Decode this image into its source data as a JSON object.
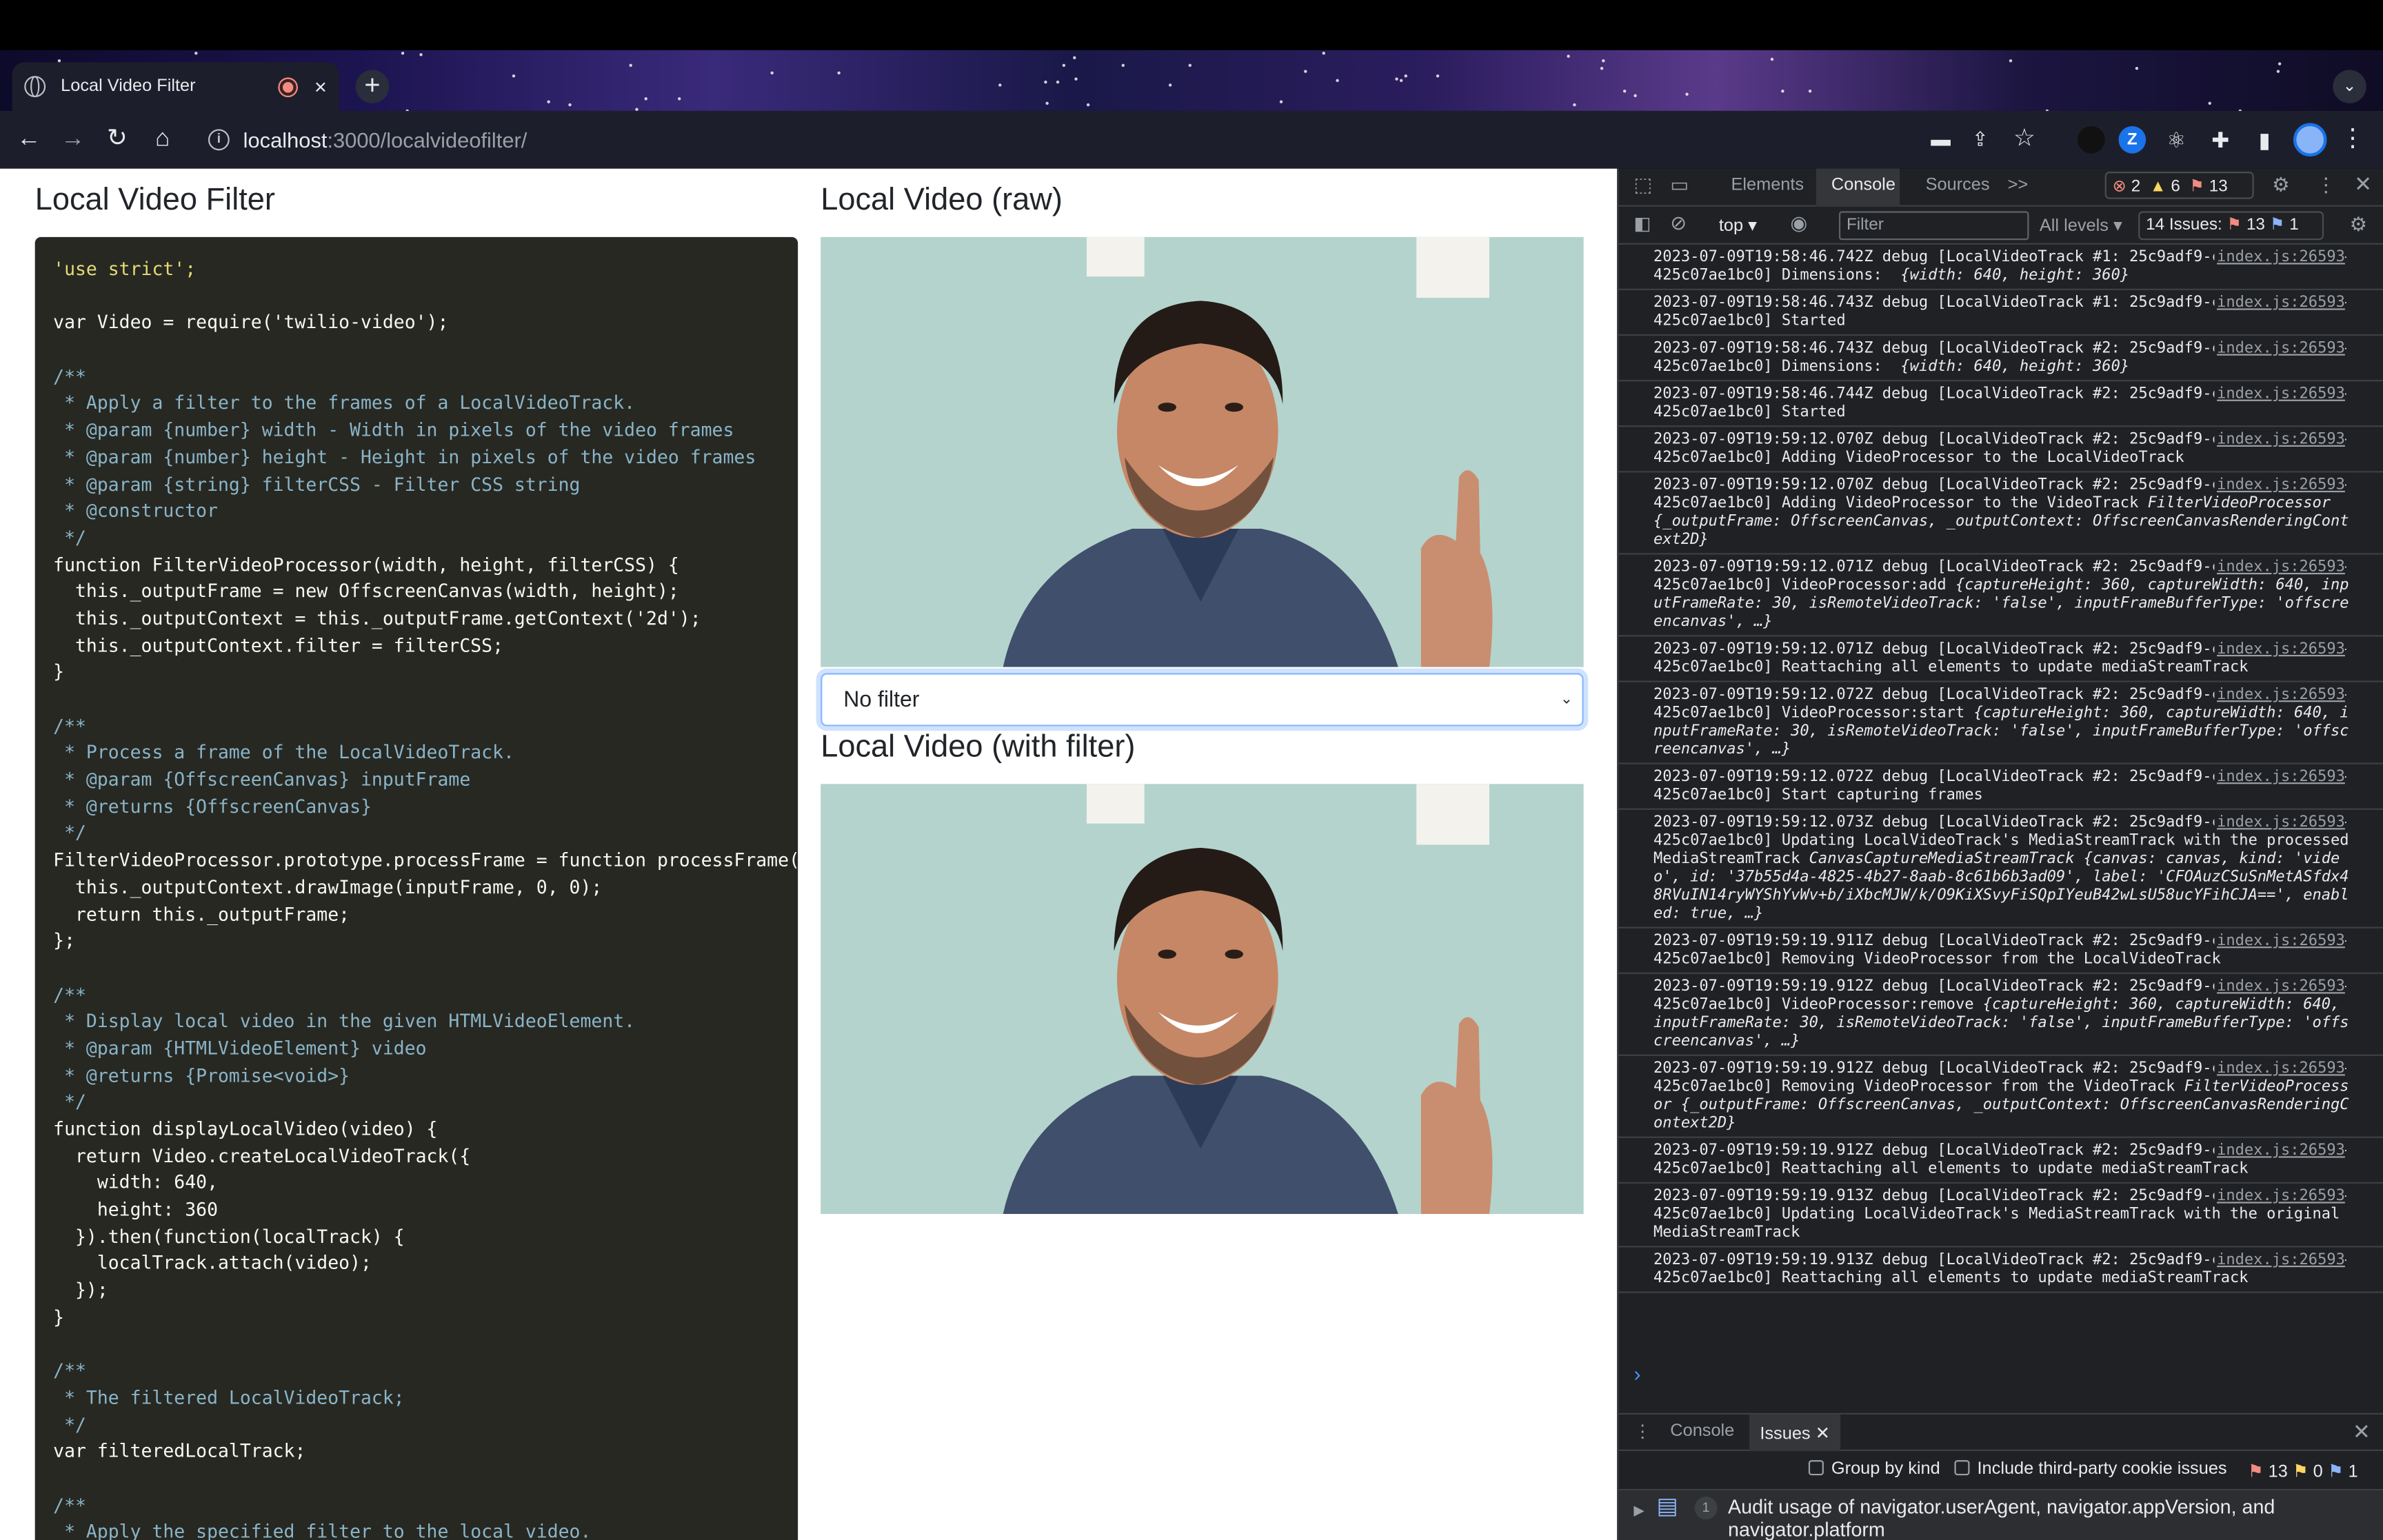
{
  "browser": {
    "tab_title": "Local Video Filter",
    "tab_close": "×",
    "new_tab": "+",
    "url_host": "localhost",
    "url_path": ":3000/localvideofilter/"
  },
  "page": {
    "code_title": "Local Video Filter",
    "raw_title": "Local Video (raw)",
    "filter_title": "Local Video (with filter)",
    "filter_select_value": "No filter"
  },
  "devtools": {
    "tabs": [
      "Elements",
      "Console",
      "Sources",
      ">>"
    ],
    "errors_count": "2",
    "warnings_count": "6",
    "issues_count": "13",
    "context": "top",
    "filter_placeholder": "Filter",
    "levels": "All levels",
    "issues_label": "14 Issues:",
    "issues_err": "13",
    "issues_info": "1",
    "drawer_tabs": [
      "Console",
      "Issues"
    ],
    "group_by_kind": "Group by kind",
    "third_party": "Include third-party cookie issues",
    "issue_counts": [
      "13",
      "0",
      "1"
    ],
    "issue_badge": "1",
    "issue_text": "Audit usage of navigator.userAgent, navigator.appVersion, and navigator.platform",
    "messages": [
      {
        "text": "2023-07-09T19:58:46.742Z debug [LocalVideoTrack #1: 25c9adf9-c766-4104-b74d-425c07ae1bc0] Dimensions: ",
        "obj": "{width: 640, height: 360}",
        "src": "index.js:26593"
      },
      {
        "text": "2023-07-09T19:58:46.743Z debug [LocalVideoTrack #1: 25c9adf9-c766-4104-b74d-425c07ae1bc0] Started",
        "obj": "",
        "src": "index.js:26593"
      },
      {
        "text": "2023-07-09T19:58:46.743Z debug [LocalVideoTrack #2: 25c9adf9-c766-4104-b74d-425c07ae1bc0] Dimensions: ",
        "obj": "{width: 640, height: 360}",
        "src": "index.js:26593"
      },
      {
        "text": "2023-07-09T19:58:46.744Z debug [LocalVideoTrack #2: 25c9adf9-c766-4104-b74d-425c07ae1bc0] Started",
        "obj": "",
        "src": "index.js:26593"
      },
      {
        "text": "2023-07-09T19:59:12.070Z debug [LocalVideoTrack #2: 25c9adf9-c766-4104-b74d-425c07ae1bc0] Adding VideoProcessor to the LocalVideoTrack",
        "obj": "",
        "src": "index.js:26593"
      },
      {
        "text": "2023-07-09T19:59:12.070Z debug [LocalVideoTrack #2: 25c9adf9-c766-4104-b74d-425c07ae1bc0] Adding VideoProcessor to the VideoTrack",
        "obj": "FilterVideoProcessor {_outputFrame: OffscreenCanvas, _outputContext: OffscreenCanvasRenderingContext2D}",
        "src": "index.js:26593"
      },
      {
        "text": "2023-07-09T19:59:12.071Z debug [LocalVideoTrack #2: 25c9adf9-c766-4104-b74d-425c07ae1bc0] VideoProcessor:add",
        "obj": "{captureHeight: 360, captureWidth: 640, inputFrameRate: 30, isRemoteVideoTrack: 'false', inputFrameBufferType: 'offscreencanvas', …}",
        "src": "index.js:26593"
      },
      {
        "text": "2023-07-09T19:59:12.071Z debug [LocalVideoTrack #2: 25c9adf9-c766-4104-b74d-425c07ae1bc0] Reattaching all elements to update mediaStreamTrack",
        "obj": "",
        "src": "index.js:26593"
      },
      {
        "text": "2023-07-09T19:59:12.072Z debug [LocalVideoTrack #2: 25c9adf9-c766-4104-b74d-425c07ae1bc0] VideoProcessor:start",
        "obj": "{captureHeight: 360, captureWidth: 640, inputFrameRate: 30, isRemoteVideoTrack: 'false', inputFrameBufferType: 'offscreencanvas', …}",
        "src": "index.js:26593"
      },
      {
        "text": "2023-07-09T19:59:12.072Z debug [LocalVideoTrack #2: 25c9adf9-c766-4104-b74d-425c07ae1bc0] Start capturing frames",
        "obj": "",
        "src": "index.js:26593"
      },
      {
        "text": "2023-07-09T19:59:12.073Z debug [LocalVideoTrack #2: 25c9adf9-c766-4104-b74d-425c07ae1bc0] Updating LocalVideoTrack's MediaStreamTrack with the processed MediaStreamTrack",
        "obj": "CanvasCaptureMediaStreamTrack {canvas: canvas, kind: 'video', id: '37b55d4a-4825-4b27-8aab-8c61b6b3ad09', label: 'CFOAuzCSuSnMetASfdx48RVuIN14ryWYShYvWv+b/iXbcMJW/k/O9KiXSvyFiSQpIYeuB42wLsU58ucYFihCJA==', enabled: true, …}",
        "src": "index.js:26593"
      },
      {
        "text": "2023-07-09T19:59:19.911Z debug [LocalVideoTrack #2: 25c9adf9-c766-4104-b74d-425c07ae1bc0] Removing VideoProcessor from the LocalVideoTrack",
        "obj": "",
        "src": "index.js:26593"
      },
      {
        "text": "2023-07-09T19:59:19.912Z debug [LocalVideoTrack #2: 25c9adf9-c766-4104-b74d-425c07ae1bc0] VideoProcessor:remove",
        "obj": "{captureHeight: 360, captureWidth: 640, inputFrameRate: 30, isRemoteVideoTrack: 'false', inputFrameBufferType: 'offscreencanvas', …}",
        "src": "index.js:26593"
      },
      {
        "text": "2023-07-09T19:59:19.912Z debug [LocalVideoTrack #2: 25c9adf9-c766-4104-b74d-425c07ae1bc0] Removing VideoProcessor from the VideoTrack",
        "obj": "FilterVideoProcessor {_outputFrame: OffscreenCanvas, _outputContext: OffscreenCanvasRenderingContext2D}",
        "src": "index.js:26593"
      },
      {
        "text": "2023-07-09T19:59:19.912Z debug [LocalVideoTrack #2: 25c9adf9-c766-4104-b74d-425c07ae1bc0] Reattaching all elements to update mediaStreamTrack",
        "obj": "",
        "src": "index.js:26593"
      },
      {
        "text": "2023-07-09T19:59:19.913Z debug [LocalVideoTrack #2: 25c9adf9-c766-4104-b74d-425c07ae1bc0] Updating LocalVideoTrack's MediaStreamTrack with the original MediaStreamTrack",
        "obj": "",
        "src": "index.js:26593"
      },
      {
        "text": "2023-07-09T19:59:19.913Z debug [LocalVideoTrack #2: 25c9adf9-c766-4104-b74d-425c07ae1bc0] Reattaching all elements to update mediaStreamTrack",
        "obj": "",
        "src": "index.js:26593"
      }
    ]
  },
  "code_lines": [
    "'use strict';",
    "",
    "var Video = require('twilio-video');",
    "",
    "/**",
    " * Apply a filter to the frames of a LocalVideoTrack.",
    " * @param {number} width - Width in pixels of the video frames",
    " * @param {number} height - Height in pixels of the video frames",
    " * @param {string} filterCSS - Filter CSS string",
    " * @constructor",
    " */",
    "function FilterVideoProcessor(width, height, filterCSS) {",
    "  this._outputFrame = new OffscreenCanvas(width, height);",
    "  this._outputContext = this._outputFrame.getContext('2d');",
    "  this._outputContext.filter = filterCSS;",
    "}",
    "",
    "/**",
    " * Process a frame of the LocalVideoTrack.",
    " * @param {OffscreenCanvas} inputFrame",
    " * @returns {OffscreenCanvas}",
    " */",
    "FilterVideoProcessor.prototype.processFrame = function processFrame(inputFrame) {",
    "  this._outputContext.drawImage(inputFrame, 0, 0);",
    "  return this._outputFrame;",
    "};",
    "",
    "/**",
    " * Display local video in the given HTMLVideoElement.",
    " * @param {HTMLVideoElement} video",
    " * @returns {Promise<void>}",
    " */",
    "function displayLocalVideo(video) {",
    "  return Video.createLocalVideoTrack({",
    "    width: 640,",
    "    height: 360",
    "  }).then(function(localTrack) {",
    "    localTrack.attach(video);",
    "  });",
    "}",
    "",
    "/**",
    " * The filtered LocalVideoTrack;",
    " */",
    "var filteredLocalTrack;",
    "",
    "/**",
    " * Apply the specified filter to the local video."
  ]
}
